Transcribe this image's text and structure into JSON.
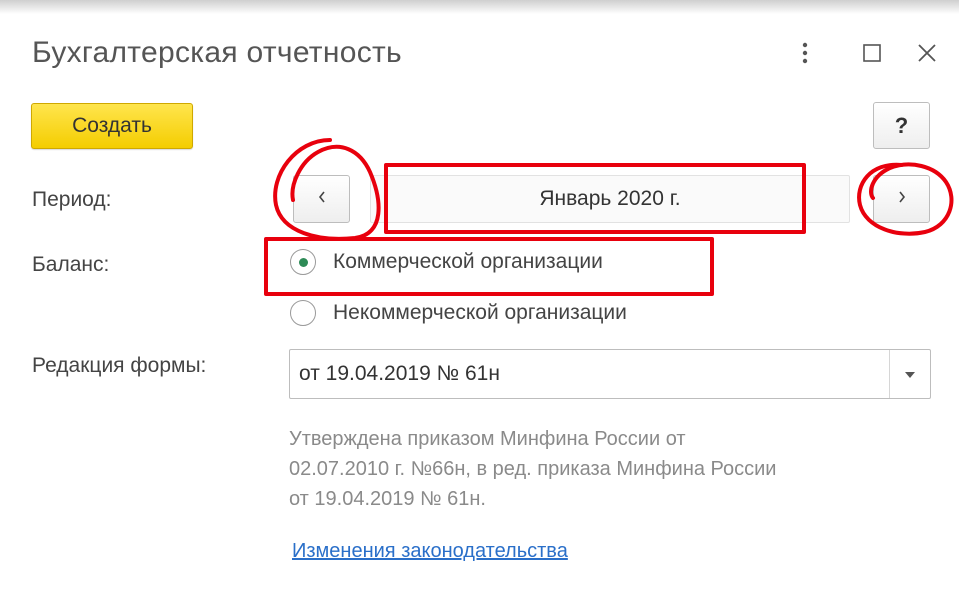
{
  "window": {
    "title": "Бухгалтерская отчетность",
    "buttons": [
      "more-icon",
      "maximize-icon",
      "close-icon"
    ]
  },
  "toolbar": {
    "create_label": "Создать",
    "help_label": "?"
  },
  "period": {
    "label": "Период:",
    "value": "Январь 2020 г.",
    "prev_label": "‹",
    "next_label": "›"
  },
  "balance": {
    "label": "Баланс:",
    "options": [
      {
        "label": "Коммерческой организации",
        "selected": true
      },
      {
        "label": "Некоммерческой организации",
        "selected": false
      }
    ]
  },
  "form_edition": {
    "label": "Редакция формы:",
    "value": "от 19.04.2019 № 61н",
    "note_lines": [
      "Утверждена приказом Минфина России от",
      "02.07.2010 г. №66н, в ред. приказа Минфина России",
      "от 19.04.2019 № 61н."
    ]
  },
  "links": {
    "legislation_changes": "Изменения законодательства"
  },
  "colors": {
    "create_button": "#f4cd00",
    "annotation": "#e8000d",
    "link": "#2a6fc9",
    "radio_selected": "#2e8b57"
  }
}
